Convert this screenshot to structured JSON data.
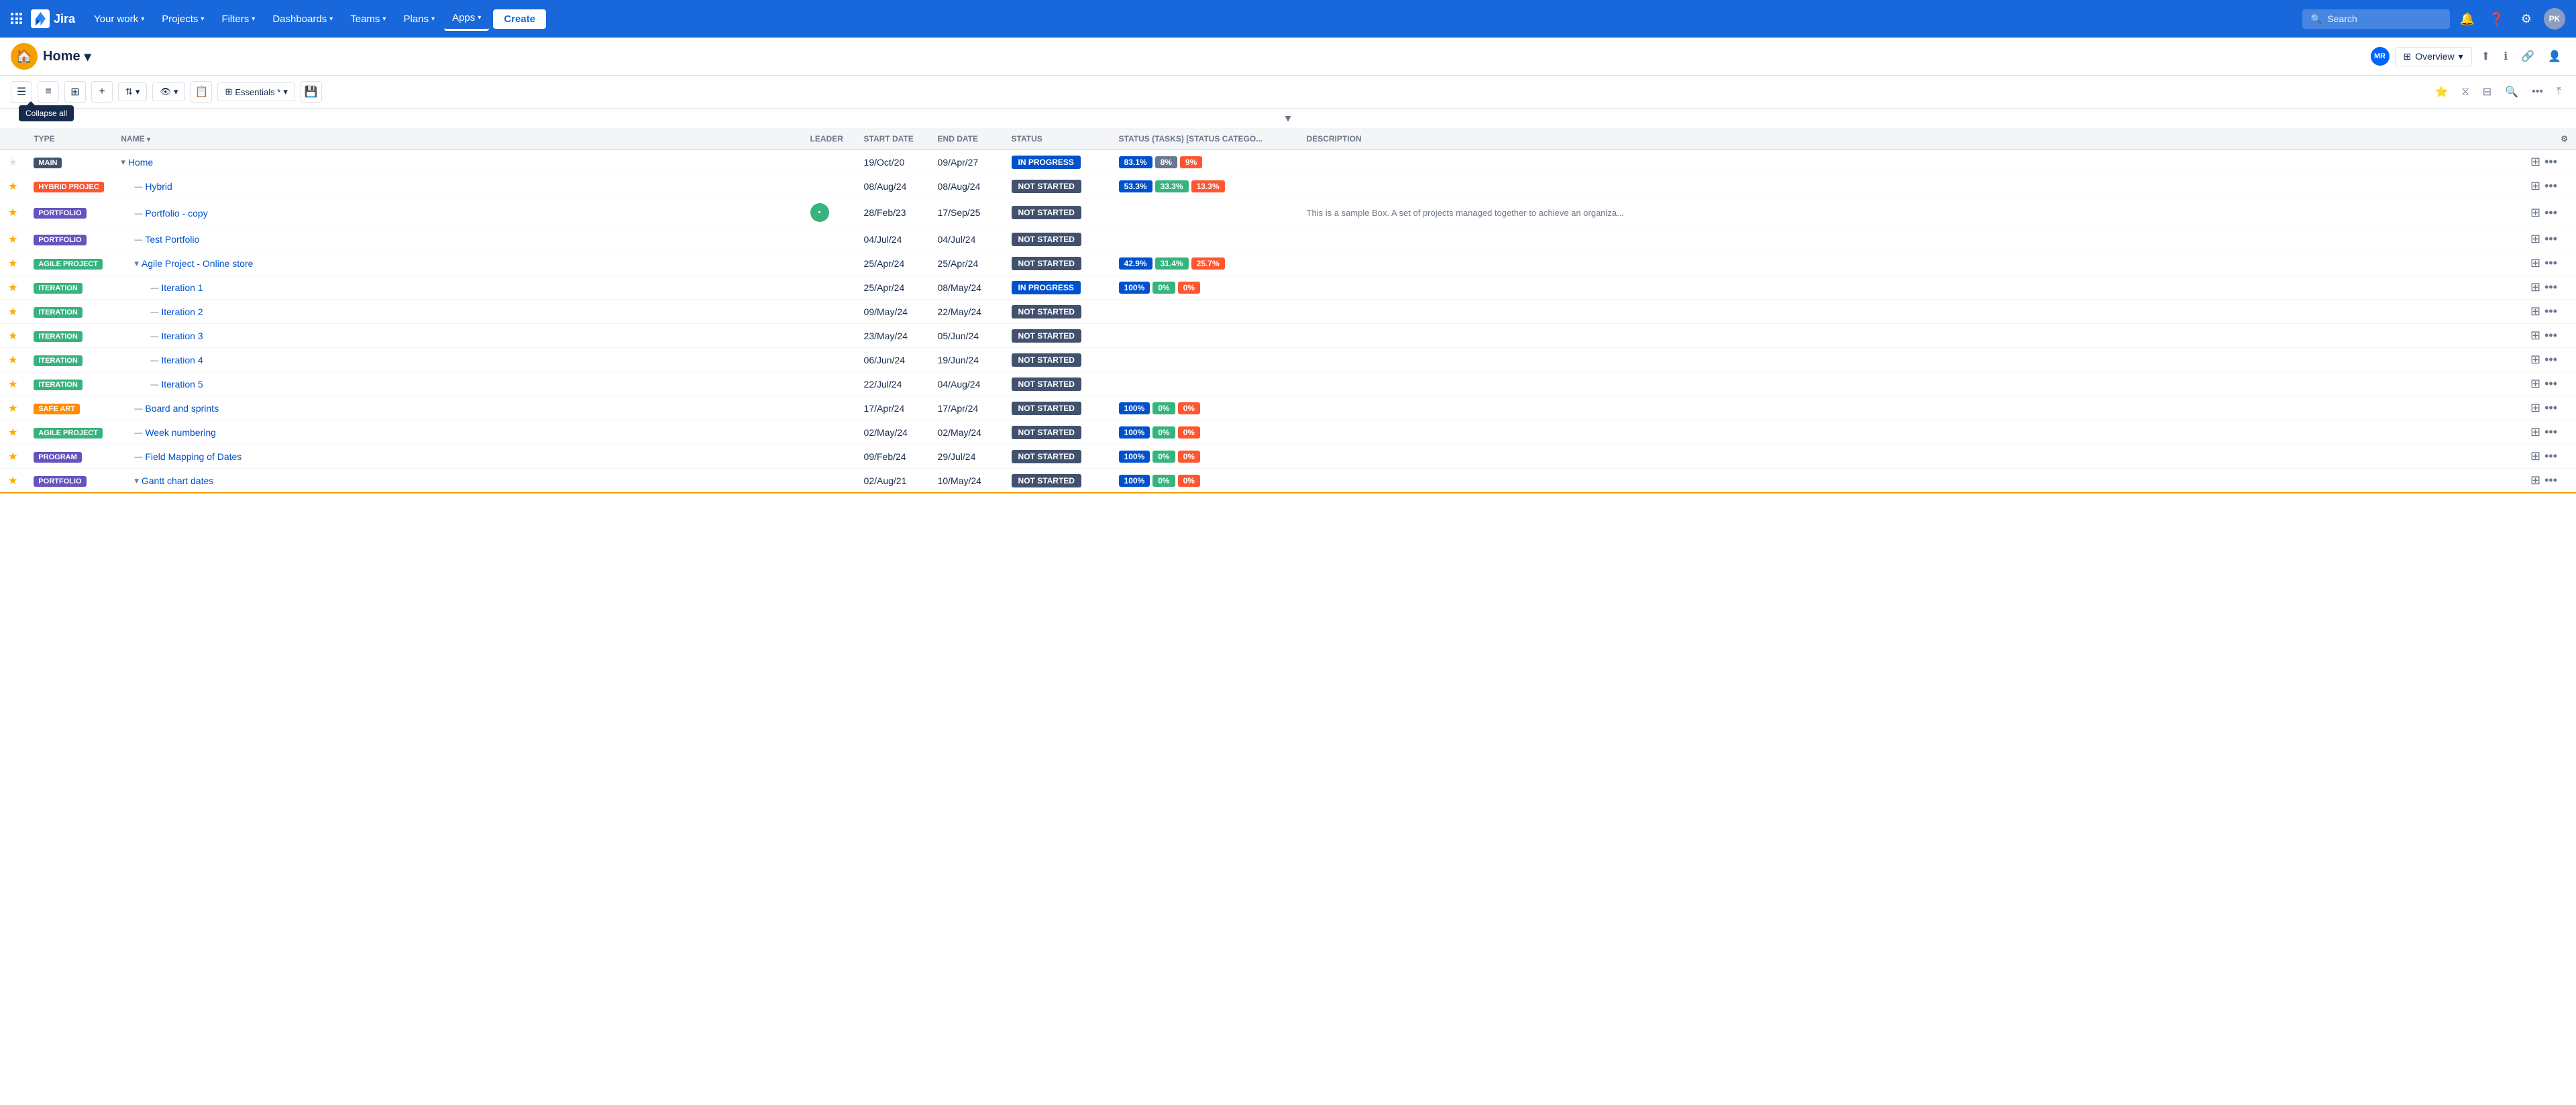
{
  "nav": {
    "logo_text": "Jira",
    "menu_items": [
      {
        "label": "Your work",
        "has_dropdown": true
      },
      {
        "label": "Projects",
        "has_dropdown": true
      },
      {
        "label": "Filters",
        "has_dropdown": true
      },
      {
        "label": "Dashboards",
        "has_dropdown": true
      },
      {
        "label": "Teams",
        "has_dropdown": true
      },
      {
        "label": "Plans",
        "has_dropdown": true
      },
      {
        "label": "Apps",
        "has_dropdown": true,
        "active": true
      }
    ],
    "create_label": "Create",
    "search_placeholder": "Search",
    "user_initials": "PK"
  },
  "secondary_nav": {
    "home_label": "Home",
    "overview_label": "Overview",
    "user_initials": "MR"
  },
  "toolbar": {
    "collapse_tooltip": "Collapse all",
    "essentials_label": "Essentials *",
    "view_settings_label": "View settings"
  },
  "table": {
    "columns": [
      "FAV",
      "TYPE",
      "NAME",
      "LEADER",
      "START DATE",
      "END DATE",
      "STATUS",
      "STATUS (TASKS) [STATUS CATEGO...",
      "DESCRIPTION"
    ],
    "rows": [
      {
        "id": "main-home",
        "fav": false,
        "type": "MAIN",
        "type_class": "badge-main",
        "indent": 0,
        "expand": true,
        "name": "Home",
        "leader": "",
        "start_date": "19/Oct/20",
        "end_date": "09/Apr/27",
        "status": "IN PROGRESS",
        "status_class": "status-in-progress",
        "pct_badges": [
          {
            "value": "83.1%",
            "class": "pct-blue"
          },
          {
            "value": "8%",
            "class": "pct-gray"
          },
          {
            "value": "9%",
            "class": "pct-red"
          }
        ],
        "description": ""
      },
      {
        "id": "hybrid",
        "fav": true,
        "type": "HYBRID PROJEC",
        "type_class": "badge-hybrid",
        "indent": 1,
        "expand": false,
        "name": "Hybrid",
        "leader": "",
        "start_date": "08/Aug/24",
        "end_date": "08/Aug/24",
        "status": "NOT STARTED",
        "status_class": "status-not-started",
        "pct_badges": [
          {
            "value": "53.3%",
            "class": "pct-blue"
          },
          {
            "value": "33.3%",
            "class": "pct-green"
          },
          {
            "value": "13.3%",
            "class": "pct-red"
          }
        ],
        "description": ""
      },
      {
        "id": "portfolio-copy",
        "fav": true,
        "type": "PORTFOLIO",
        "type_class": "badge-portfolio",
        "indent": 1,
        "expand": false,
        "name": "Portfolio - copy",
        "leader": "dot",
        "start_date": "28/Feb/23",
        "end_date": "17/Sep/25",
        "status": "NOT STARTED",
        "status_class": "status-not-started",
        "pct_badges": [],
        "description": "This is a sample Box. A set of projects managed together to achieve an organiza..."
      },
      {
        "id": "test-portfolio",
        "fav": true,
        "type": "PORTFOLIO",
        "type_class": "badge-portfolio",
        "indent": 1,
        "expand": false,
        "name": "Test Portfolio",
        "leader": "",
        "start_date": "04/Jul/24",
        "end_date": "04/Jul/24",
        "status": "NOT STARTED",
        "status_class": "status-not-started",
        "pct_badges": [],
        "description": ""
      },
      {
        "id": "agile-online-store",
        "fav": true,
        "type": "AGILE PROJECT",
        "type_class": "badge-agile",
        "indent": 1,
        "expand": true,
        "name": "Agile Project - Online store",
        "leader": "",
        "start_date": "25/Apr/24",
        "end_date": "25/Apr/24",
        "status": "NOT STARTED",
        "status_class": "status-not-started",
        "pct_badges": [
          {
            "value": "42.9%",
            "class": "pct-blue"
          },
          {
            "value": "31.4%",
            "class": "pct-green"
          },
          {
            "value": "25.7%",
            "class": "pct-red"
          }
        ],
        "description": ""
      },
      {
        "id": "iteration-1",
        "fav": true,
        "type": "ITERATION",
        "type_class": "badge-iteration",
        "indent": 2,
        "expand": false,
        "name": "Iteration 1",
        "leader": "",
        "start_date": "25/Apr/24",
        "end_date": "08/May/24",
        "status": "IN PROGRESS",
        "status_class": "status-in-progress",
        "pct_badges": [
          {
            "value": "100%",
            "class": "pct-blue"
          },
          {
            "value": "0%",
            "class": "pct-green"
          },
          {
            "value": "0%",
            "class": "pct-red"
          }
        ],
        "description": ""
      },
      {
        "id": "iteration-2",
        "fav": true,
        "type": "ITERATION",
        "type_class": "badge-iteration",
        "indent": 2,
        "expand": false,
        "name": "Iteration 2",
        "leader": "",
        "start_date": "09/May/24",
        "end_date": "22/May/24",
        "status": "NOT STARTED",
        "status_class": "status-not-started",
        "pct_badges": [],
        "description": ""
      },
      {
        "id": "iteration-3",
        "fav": true,
        "type": "ITERATION",
        "type_class": "badge-iteration",
        "indent": 2,
        "expand": false,
        "name": "Iteration 3",
        "leader": "",
        "start_date": "23/May/24",
        "end_date": "05/Jun/24",
        "status": "NOT STARTED",
        "status_class": "status-not-started",
        "pct_badges": [],
        "description": ""
      },
      {
        "id": "iteration-4",
        "fav": true,
        "type": "ITERATION",
        "type_class": "badge-iteration",
        "indent": 2,
        "expand": false,
        "name": "Iteration 4",
        "leader": "",
        "start_date": "06/Jun/24",
        "end_date": "19/Jun/24",
        "status": "NOT STARTED",
        "status_class": "status-not-started",
        "pct_badges": [],
        "description": ""
      },
      {
        "id": "iteration-5",
        "fav": true,
        "type": "ITERATION",
        "type_class": "badge-iteration",
        "indent": 2,
        "expand": false,
        "name": "Iteration 5",
        "leader": "",
        "start_date": "22/Jul/24",
        "end_date": "04/Aug/24",
        "status": "NOT STARTED",
        "status_class": "status-not-started",
        "pct_badges": [],
        "description": ""
      },
      {
        "id": "board-and-sprints",
        "fav": true,
        "type": "SAFE ART",
        "type_class": "badge-safe-art",
        "indent": 1,
        "expand": false,
        "name": "Board and sprints",
        "leader": "",
        "start_date": "17/Apr/24",
        "end_date": "17/Apr/24",
        "status": "NOT STARTED",
        "status_class": "status-not-started",
        "pct_badges": [
          {
            "value": "100%",
            "class": "pct-blue"
          },
          {
            "value": "0%",
            "class": "pct-green"
          },
          {
            "value": "0%",
            "class": "pct-red"
          }
        ],
        "description": ""
      },
      {
        "id": "week-numbering",
        "fav": true,
        "type": "AGILE PROJECT",
        "type_class": "badge-agile",
        "indent": 1,
        "expand": false,
        "name": "Week numbering",
        "leader": "",
        "start_date": "02/May/24",
        "end_date": "02/May/24",
        "status": "NOT STARTED",
        "status_class": "status-not-started",
        "pct_badges": [
          {
            "value": "100%",
            "class": "pct-blue"
          },
          {
            "value": "0%",
            "class": "pct-green"
          },
          {
            "value": "0%",
            "class": "pct-red"
          }
        ],
        "description": ""
      },
      {
        "id": "field-mapping",
        "fav": true,
        "type": "PROGRAM",
        "type_class": "badge-program",
        "indent": 1,
        "expand": false,
        "name": "Field Mapping of Dates",
        "leader": "",
        "start_date": "09/Feb/24",
        "end_date": "29/Jul/24",
        "status": "NOT STARTED",
        "status_class": "status-not-started",
        "pct_badges": [
          {
            "value": "100%",
            "class": "pct-blue"
          },
          {
            "value": "0%",
            "class": "pct-green"
          },
          {
            "value": "0%",
            "class": "pct-red"
          }
        ],
        "description": ""
      },
      {
        "id": "gantt-chart",
        "fav": true,
        "type": "PORTFOLIO",
        "type_class": "badge-portfolio",
        "indent": 1,
        "expand": true,
        "name": "Gantt chart dates",
        "leader": "",
        "start_date": "02/Aug/21",
        "end_date": "10/May/24",
        "status": "NOT STARTED",
        "status_class": "status-not-started",
        "pct_badges": [
          {
            "value": "100%",
            "class": "pct-blue"
          },
          {
            "value": "0%",
            "class": "pct-green"
          },
          {
            "value": "0%",
            "class": "pct-red"
          }
        ],
        "description": "",
        "bottom_border": "orange"
      }
    ]
  }
}
